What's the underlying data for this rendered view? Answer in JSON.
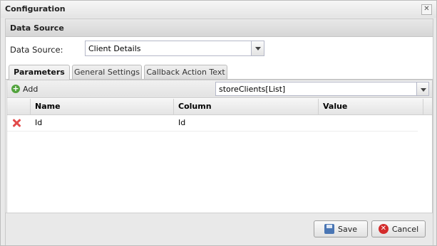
{
  "window": {
    "title": "Configuration",
    "close_glyph": "✕"
  },
  "data_source": {
    "header": "Data Source",
    "label": "Data Source:",
    "selected": "Client Details"
  },
  "tabs": [
    {
      "label": "Parameters",
      "active": true
    },
    {
      "label": "General Settings",
      "active": false
    },
    {
      "label": "Callback Action Text",
      "active": false
    }
  ],
  "toolbar": {
    "add_label": "Add",
    "add_icon": "add-icon",
    "store_selected": "storeClients[List]"
  },
  "grid": {
    "columns": [
      "Name",
      "Column",
      "Value"
    ],
    "rows": [
      {
        "name": "Id",
        "column": "Id",
        "value": ""
      }
    ]
  },
  "footer": {
    "save_label": "Save",
    "cancel_label": "Cancel"
  },
  "colors": {
    "add_icon": "#52a33d",
    "delete_icon": "#e24b4b",
    "cancel_icon": "#d32b2b",
    "save_icon": "#4a76b4"
  }
}
